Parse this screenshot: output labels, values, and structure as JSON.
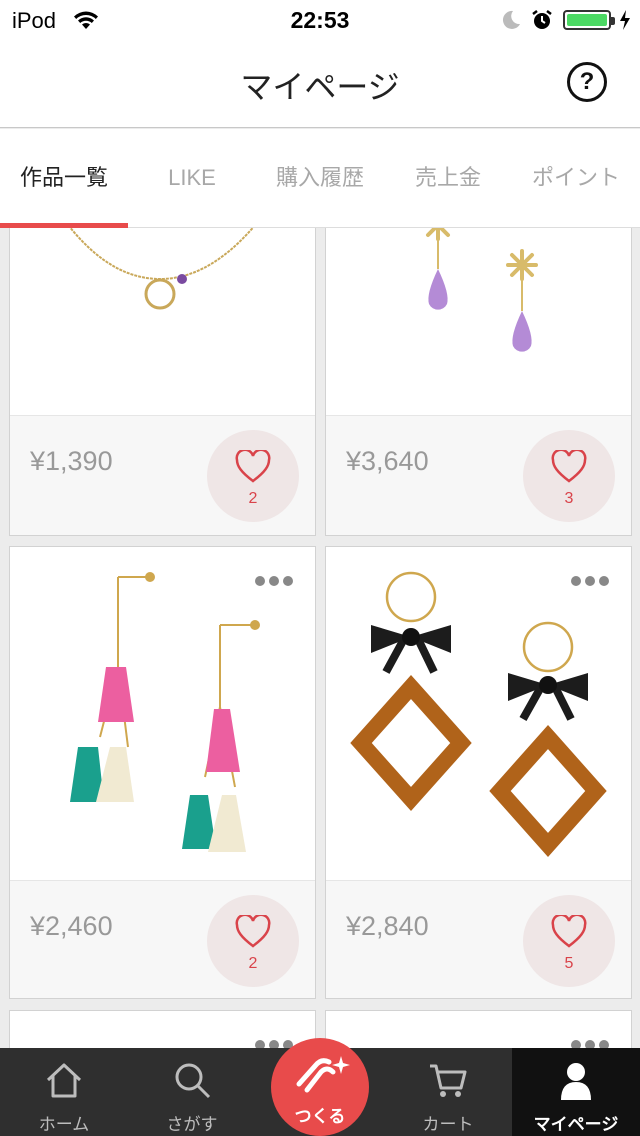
{
  "status": {
    "carrier": "iPod",
    "time": "22:53",
    "battery_level": 1.0
  },
  "nav": {
    "title": "マイページ",
    "help_label": "?"
  },
  "tabs": [
    {
      "label": "作品一覧",
      "active": true
    },
    {
      "label": "LIKE",
      "active": false
    },
    {
      "label": "購入履歴",
      "active": false
    },
    {
      "label": "売上金",
      "active": false
    },
    {
      "label": "ポイント",
      "active": false
    }
  ],
  "products": [
    {
      "price": "¥1,390",
      "likes": "2",
      "icon": "necklace-ring-image"
    },
    {
      "price": "¥3,640",
      "likes": "3",
      "icon": "snowflake-earrings-image"
    },
    {
      "price": "¥2,460",
      "likes": "2",
      "icon": "tassel-earrings-image"
    },
    {
      "price": "¥2,840",
      "likes": "5",
      "icon": "ribbon-tortoiseshell-earrings-image"
    }
  ],
  "tabbar": {
    "home": "ホーム",
    "search": "さがす",
    "make": "つくる",
    "cart": "カート",
    "mypage": "マイページ"
  },
  "colors": {
    "accent": "#e84b4b",
    "heart": "#d9434a",
    "tabbar_bg": "#2f2f2f"
  }
}
